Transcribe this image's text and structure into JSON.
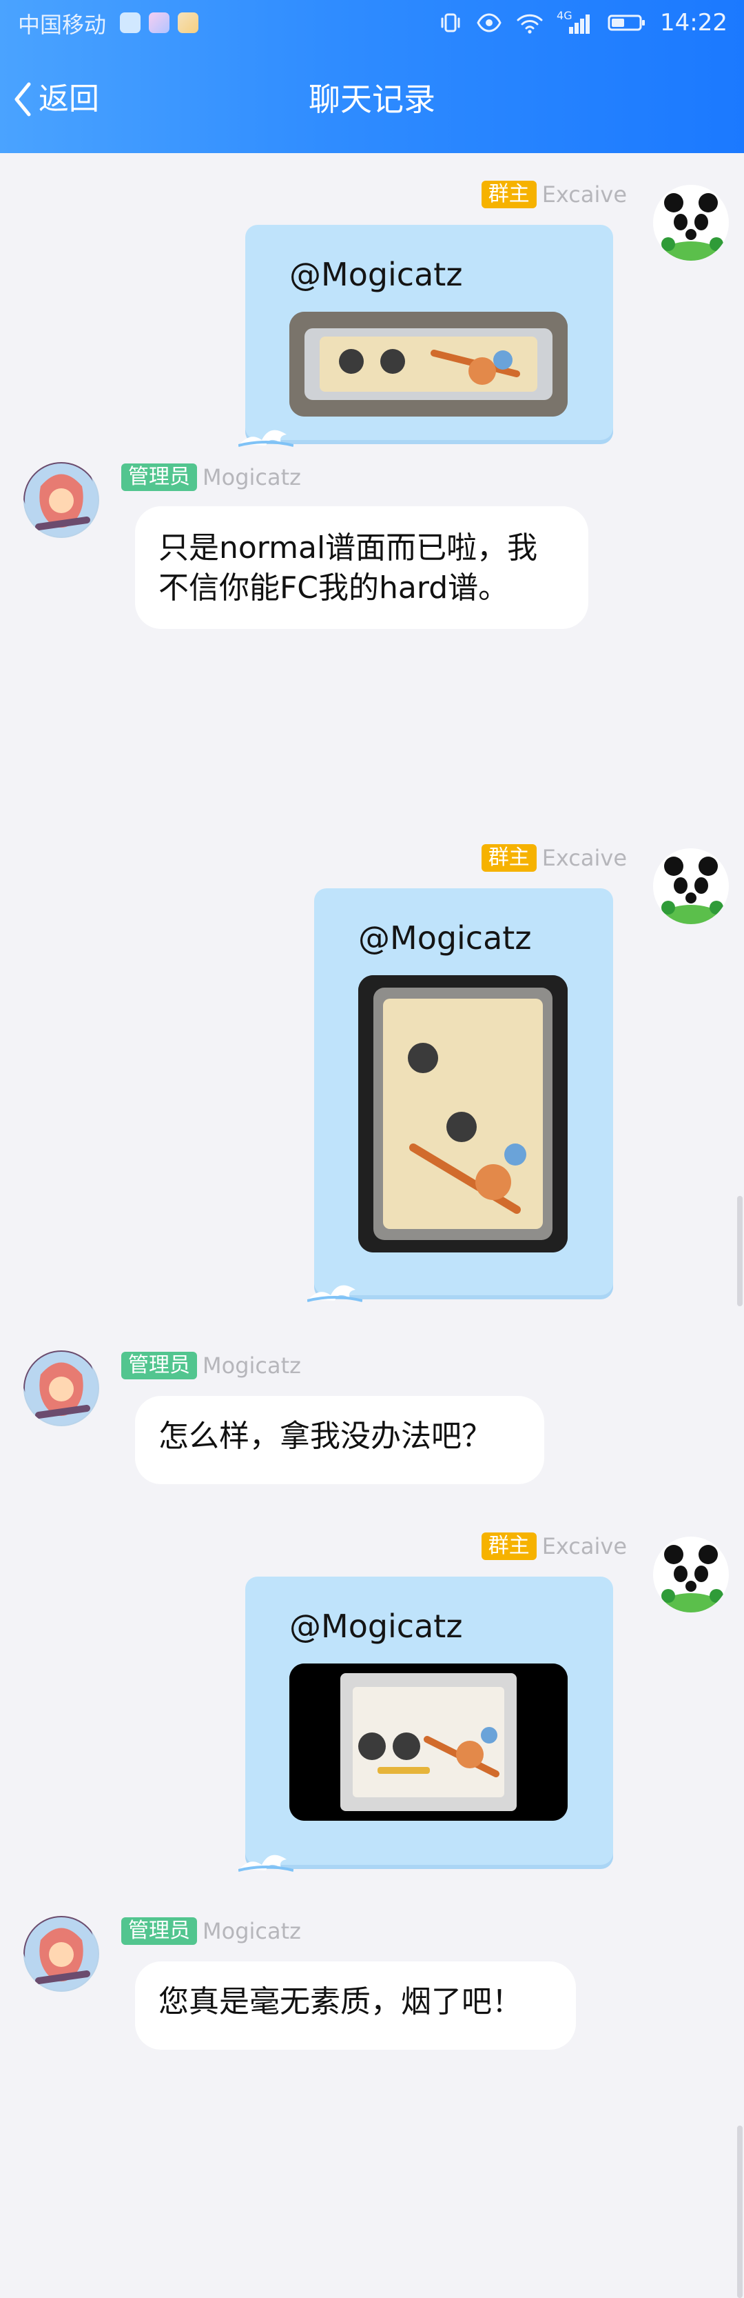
{
  "status_bar": {
    "carrier": "中国移动",
    "time": "14:22",
    "network": "4G"
  },
  "nav": {
    "back_label": "返回",
    "title": "聊天记录"
  },
  "colors": {
    "header_start": "#4aa3ff",
    "header_end": "#1b79ff",
    "owner_tag": "#f6b200",
    "admin_tag": "#52c58f",
    "outgoing_bubble": "#bfe3fb"
  },
  "messages": [
    {
      "side": "right",
      "role_tag": "群主",
      "name": "Excaive",
      "mention": "@Mogicatz",
      "image_desc": "phone-photo-1"
    },
    {
      "side": "left",
      "role_tag": "管理员",
      "name": "Mogicatz",
      "text": "只是normal谱面而已啦，我\n不信你能FC我的hard谱。"
    },
    {
      "side": "right",
      "role_tag": "群主",
      "name": "Excaive",
      "mention": "@Mogicatz",
      "image_desc": "phone-photo-2"
    },
    {
      "side": "left",
      "role_tag": "管理员",
      "name": "Mogicatz",
      "text": "怎么样，拿我没办法吧？"
    },
    {
      "side": "right",
      "role_tag": "群主",
      "name": "Excaive",
      "mention": "@Mogicatz",
      "image_desc": "phone-photo-3"
    },
    {
      "side": "left",
      "role_tag": "管理员",
      "name": "Mogicatz",
      "text": "您真是毫无素质，烟了吧！"
    }
  ]
}
